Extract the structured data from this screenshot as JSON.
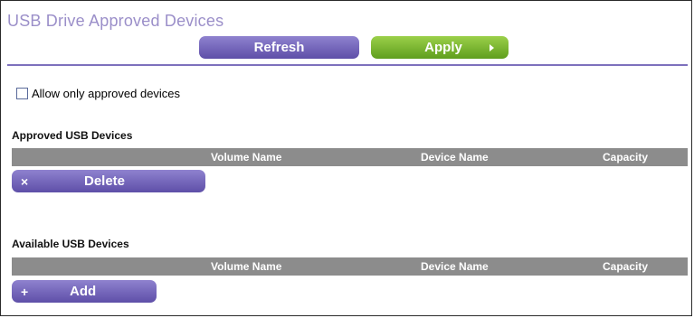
{
  "page": {
    "title": "USB Drive Approved Devices"
  },
  "toolbar": {
    "refresh_label": "Refresh",
    "apply_label": "Apply"
  },
  "settings": {
    "allow_only_approved_label": "Allow only approved devices",
    "allow_only_approved_checked": false
  },
  "approved_section": {
    "title": "Approved USB Devices",
    "columns": [
      "Volume Name",
      "Device Name",
      "Capacity"
    ],
    "rows": [],
    "delete_icon": "×",
    "delete_label": "Delete"
  },
  "available_section": {
    "title": "Available USB Devices",
    "columns": [
      "Volume Name",
      "Device Name",
      "Capacity"
    ],
    "rows": [],
    "add_icon": "+",
    "add_label": "Add"
  },
  "colors": {
    "title": "#9b8fc9",
    "purple_button": "#6b5cb5",
    "green_button": "#7ab832",
    "header_gray": "#8c8c8c",
    "rule": "#7d70bd"
  }
}
